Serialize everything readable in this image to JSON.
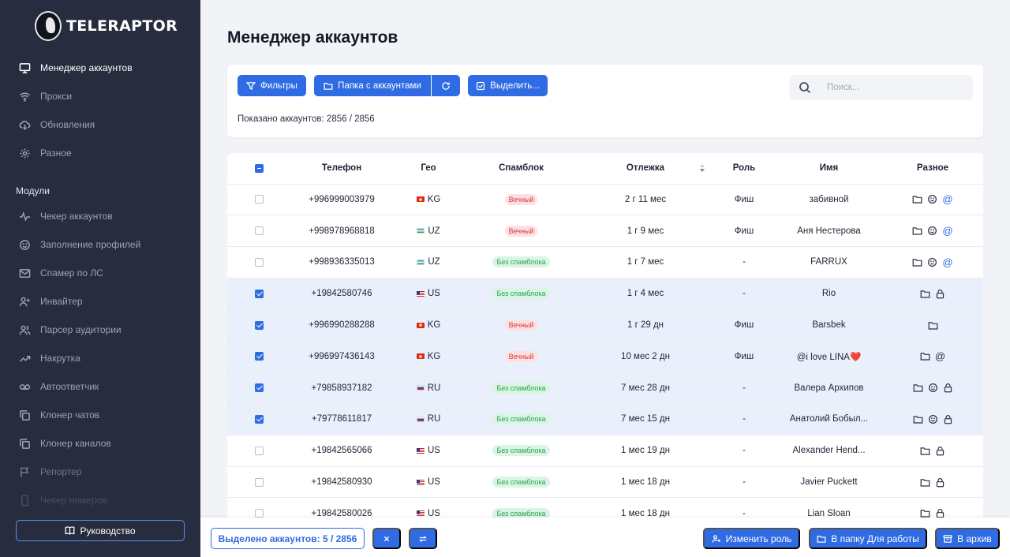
{
  "app": {
    "logo_text": "TELERAPTOR"
  },
  "sidebar": {
    "items": [
      {
        "label": "Менеджер аккаунтов",
        "icon": "monitor-icon"
      },
      {
        "label": "Прокси",
        "icon": "wifi-icon"
      },
      {
        "label": "Обновления",
        "icon": "cloud-download-icon"
      },
      {
        "label": "Разное",
        "icon": "gear-icon"
      }
    ],
    "section_title": "Модули",
    "modules": [
      {
        "label": "Чекер аккаунтов",
        "icon": "pulse-icon"
      },
      {
        "label": "Заполнение профилей",
        "icon": "smile-icon"
      },
      {
        "label": "Спамер по ЛС",
        "icon": "mail-icon"
      },
      {
        "label": "Инвайтер",
        "icon": "user-plus-icon"
      },
      {
        "label": "Парсер аудитории",
        "icon": "users-icon"
      },
      {
        "label": "Накрутка",
        "icon": "trending-up-icon"
      },
      {
        "label": "Автоответчик",
        "icon": "voicemail-icon"
      },
      {
        "label": "Клонер чатов",
        "icon": "copy-icon"
      },
      {
        "label": "Клонер каналов",
        "icon": "copy-icon"
      },
      {
        "label": "Репортер",
        "icon": "flag-icon"
      },
      {
        "label": "Чекер номеров",
        "icon": "phone-icon"
      }
    ],
    "guide_label": "Руководство"
  },
  "page": {
    "title": "Менеджер аккаунтов",
    "toolbar": {
      "filters_label": "Фильтры",
      "folder_label": "Папка с аккаунтами",
      "select_label": "Выделить...",
      "search_placeholder": "Поиск...",
      "shown_count": "Показано аккаунтов: 2856 / 2856"
    }
  },
  "table": {
    "columns": [
      "Телефон",
      "Гео",
      "Спамблок",
      "Отлежка",
      "Роль",
      "Имя",
      "Разное"
    ],
    "rows": [
      {
        "selected": false,
        "phone": "+996999003979",
        "geo": "KG",
        "spam": "Вечный",
        "spam_type": "perm",
        "age": "2 г 11 мес",
        "role": "Фиш",
        "name": "забивной",
        "misc": [
          "folder",
          "smile",
          "at-blue"
        ]
      },
      {
        "selected": false,
        "phone": "+998978968818",
        "geo": "UZ",
        "spam": "Вечный",
        "spam_type": "perm",
        "age": "1 г 9 мес",
        "role": "Фиш",
        "name": "Аня Нестерова",
        "misc": [
          "folder",
          "smile",
          "at-blue"
        ]
      },
      {
        "selected": false,
        "phone": "+998936335013",
        "geo": "UZ",
        "spam": "Без спамблока",
        "spam_type": "clean",
        "age": "1 г 7 мес",
        "role": "-",
        "name": "FARRUX",
        "misc": [
          "folder",
          "smile",
          "at-blue"
        ]
      },
      {
        "selected": true,
        "phone": "+19842580746",
        "geo": "US",
        "spam": "Без спамблока",
        "spam_type": "clean",
        "age": "1 г 4 мес",
        "role": "-",
        "name": "Rio",
        "misc": [
          "folder",
          "lock"
        ]
      },
      {
        "selected": true,
        "phone": "+996990288288",
        "geo": "KG",
        "spam": "Вечный",
        "spam_type": "perm",
        "age": "1 г 29 дн",
        "role": "Фиш",
        "name": "Barsbek",
        "misc": [
          "folder"
        ]
      },
      {
        "selected": true,
        "phone": "+996997436143",
        "geo": "KG",
        "spam": "Вечный",
        "spam_type": "perm",
        "age": "10 мес 2 дн",
        "role": "Фиш",
        "name": "@i love LINA❤️",
        "misc": [
          "folder",
          "at"
        ]
      },
      {
        "selected": true,
        "phone": "+79858937182",
        "geo": "RU",
        "spam": "Без спамблока",
        "spam_type": "clean",
        "age": "7 мес 28 дн",
        "role": "-",
        "name": "Валера Архипов",
        "misc": [
          "folder",
          "smile",
          "lock"
        ]
      },
      {
        "selected": true,
        "phone": "+79778611817",
        "geo": "RU",
        "spam": "Без спамблока",
        "spam_type": "clean",
        "age": "7 мес 15 дн",
        "role": "-",
        "name": "Анатолий Бобыл...",
        "misc": [
          "folder",
          "smile",
          "lock"
        ]
      },
      {
        "selected": false,
        "phone": "+19842565066",
        "geo": "US",
        "spam": "Без спамблока",
        "spam_type": "clean",
        "age": "1 мес 19 дн",
        "role": "-",
        "name": "Alexander Hend...",
        "misc": [
          "folder",
          "lock"
        ]
      },
      {
        "selected": false,
        "phone": "+19842580930",
        "geo": "US",
        "spam": "Без спамблока",
        "spam_type": "clean",
        "age": "1 мес 18 дн",
        "role": "-",
        "name": "Javier Puckett",
        "misc": [
          "folder",
          "lock"
        ]
      },
      {
        "selected": false,
        "phone": "+19842580026",
        "geo": "US",
        "spam": "Без спамблока",
        "spam_type": "clean",
        "age": "1 мес 18 дн",
        "role": "-",
        "name": "Lian Sloan",
        "misc": [
          "folder",
          "lock"
        ]
      }
    ]
  },
  "bottom_bar": {
    "selected_count": "Выделено аккаунтов: 5 / 2856",
    "change_role_label": "Изменить роль",
    "move_folder_label": "В папку Для работы",
    "archive_label": "В архив"
  },
  "colors": {
    "accent": "#2f6be3",
    "sidebar_bg": "#272d3f",
    "perm_badge": "#d73a42",
    "clean_badge": "#2aa257"
  }
}
